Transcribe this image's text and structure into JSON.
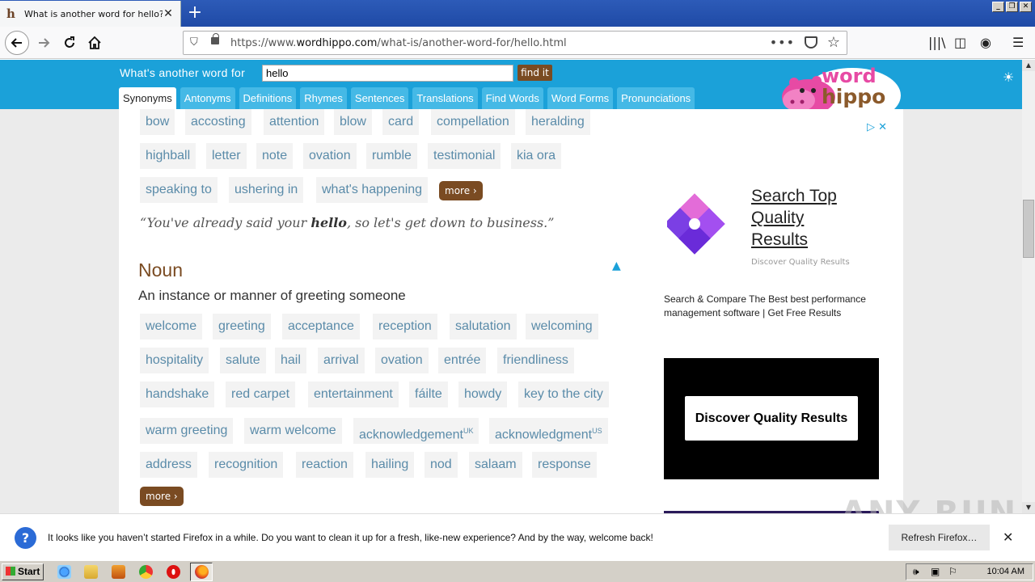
{
  "browser": {
    "tab_title": "What is another word for hello? | H",
    "url_prefix": "https://www.",
    "url_domain": "wordhippo.com",
    "url_path": "/what-is/another-word-for/hello.html"
  },
  "site": {
    "lookup_label": "What's another word for",
    "search_value": "hello",
    "find_button": "find it",
    "tabs": [
      "Synonyms",
      "Antonyms",
      "Definitions",
      "Rhymes",
      "Sentences",
      "Translations",
      "Find Words",
      "Word Forms",
      "Pronunciations"
    ],
    "logo_top": "word",
    "logo_bottom": "hippo"
  },
  "interjection_words": {
    "row1": [
      "bow",
      "accosting",
      "attention",
      "blow",
      "card",
      "compellation",
      "heralding"
    ],
    "row2": [
      "highball",
      "letter",
      "note",
      "ovation",
      "rumble",
      "testimonial",
      "kia ora"
    ],
    "row3": [
      "speaking to",
      "ushering in",
      "what's happening"
    ],
    "more_label": "more"
  },
  "quote": {
    "before": "“You've already said your ",
    "bold": "hello",
    "after": ", so let's get down to business.”"
  },
  "noun": {
    "heading": "Noun",
    "definition": "An instance or manner of greeting someone",
    "row1": [
      "welcome",
      "greeting",
      "acceptance",
      "reception",
      "salutation",
      "welcoming"
    ],
    "row2": [
      "hospitality",
      "salute",
      "hail",
      "arrival",
      "ovation",
      "entrée",
      "friendliness"
    ],
    "row3": [
      "handshake",
      "red carpet",
      "entertainment",
      "fáilte",
      "howdy",
      "key to the city"
    ],
    "row4": [
      {
        "word": "warm greeting",
        "sup": ""
      },
      {
        "word": "warm welcome",
        "sup": ""
      },
      {
        "word": "acknowledgement",
        "sup": "UK"
      },
      {
        "word": "acknowledgment",
        "sup": "US"
      }
    ],
    "row5": [
      "address",
      "recognition",
      "reaction",
      "hailing",
      "nod",
      "salaam",
      "response"
    ],
    "more_label": "more"
  },
  "ad": {
    "headline": "Search Top Quality Results",
    "subtext": "Discover Quality Results",
    "description": "Search & Compare The Best best performance management software | Get Free Results",
    "button": "Discover Quality Results"
  },
  "notification": {
    "message": "It looks like you haven’t started Firefox in a while. Do you want to clean it up for a fresh, like-new experience? And by the way, welcome back!",
    "button": "Refresh Firefox…"
  },
  "taskbar": {
    "start": "Start",
    "clock": "10:04 AM"
  },
  "watermark": "ANY RUN",
  "colors": {
    "header_blue": "#1ba1d9",
    "brown": "#7a4b22",
    "chip_text": "#5a8ba9"
  }
}
